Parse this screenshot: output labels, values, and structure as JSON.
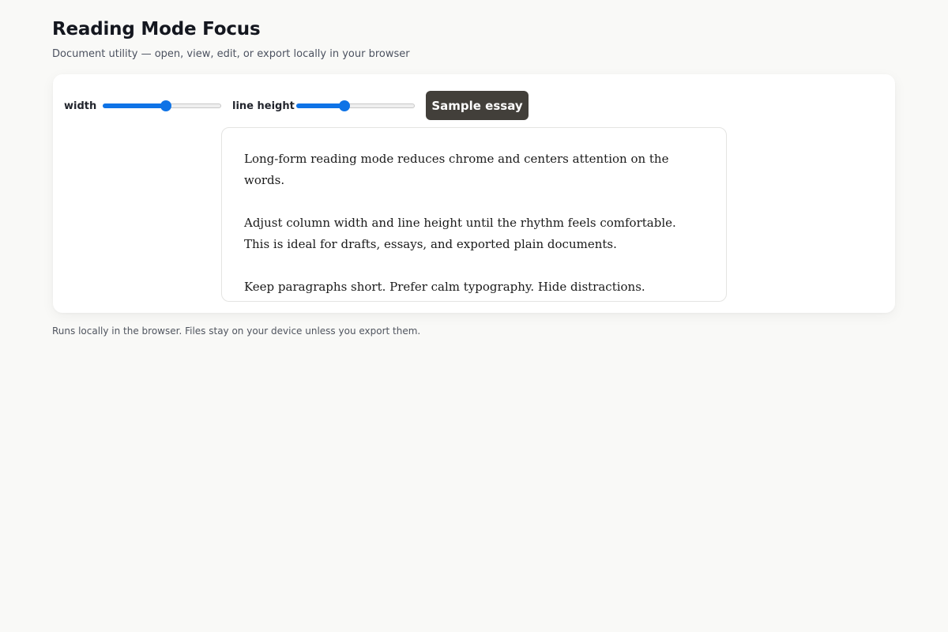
{
  "header": {
    "title": "Reading Mode Focus",
    "subtitle": "Document utility — open, view, edit, or export locally in your browser"
  },
  "controls": {
    "width_label": "width",
    "width_value": 0.53,
    "line_height_label": "line height",
    "line_height_value": 0.41,
    "sample_button_label": "Sample essay"
  },
  "reader": {
    "paragraphs": [
      "Long-form reading mode reduces chrome and centers attention on the words.",
      "Adjust column width and line height until the rhythm feels comfortable. This is ideal for drafts, essays, and exported plain documents.",
      "Keep paragraphs short. Prefer calm typography. Hide distractions."
    ]
  },
  "footer": {
    "note": "Runs locally in the browser. Files stay on your device unless you export them."
  },
  "colors": {
    "accent": "#0f73e6",
    "button_bg": "#423f3a",
    "page_bg": "#f9f9f7"
  }
}
